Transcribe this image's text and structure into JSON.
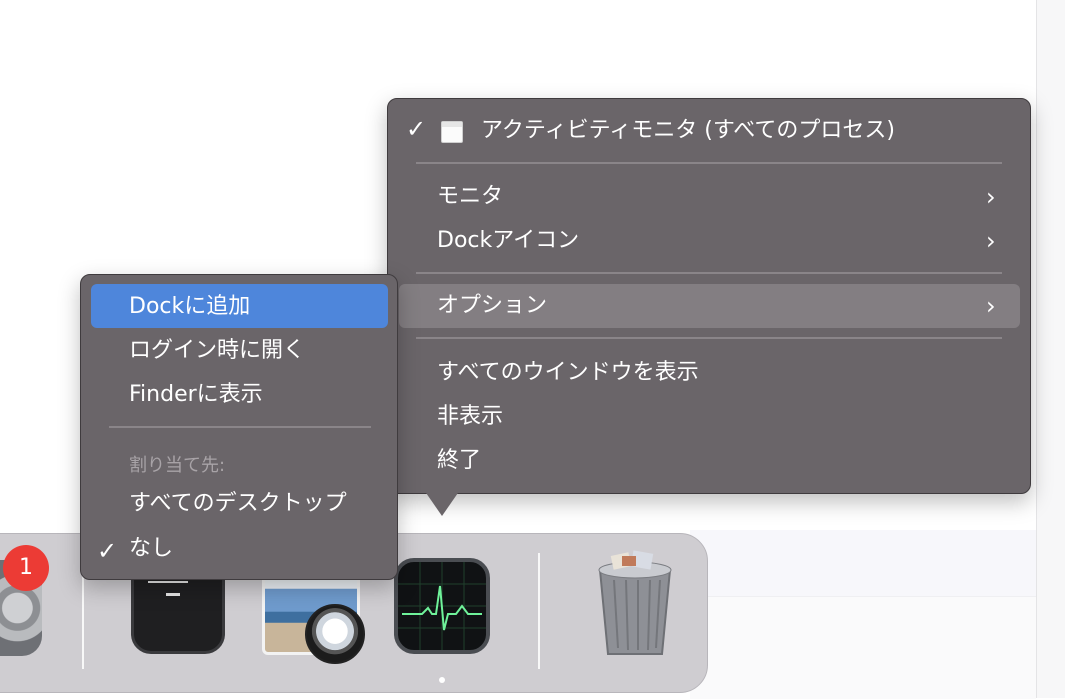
{
  "main_menu": {
    "title_item": "アクティビティモニタ (すべてのプロセス)",
    "monitor": "モニタ",
    "dock_icon": "Dockアイコン",
    "options": "オプション",
    "show_all_windows": "すべてのウインドウを表示",
    "hide": "非表示",
    "quit": "終了"
  },
  "options_submenu": {
    "add_to_dock": "Dockに追加",
    "open_at_login": "ログイン時に開く",
    "show_in_finder": "Finderに表示",
    "assign_to_label": "割り当て先:",
    "all_desktops": "すべてのデスクトップ",
    "none": "なし"
  },
  "dock": {
    "system_prefs_badge": "1"
  },
  "glyphs": {
    "check": "✓",
    "chevron": "›"
  },
  "colors": {
    "menu_bg": "#6a6569",
    "highlight_gray": "#837e82",
    "highlight_blue": "#4e86db",
    "badge_red": "#ec3b35"
  }
}
